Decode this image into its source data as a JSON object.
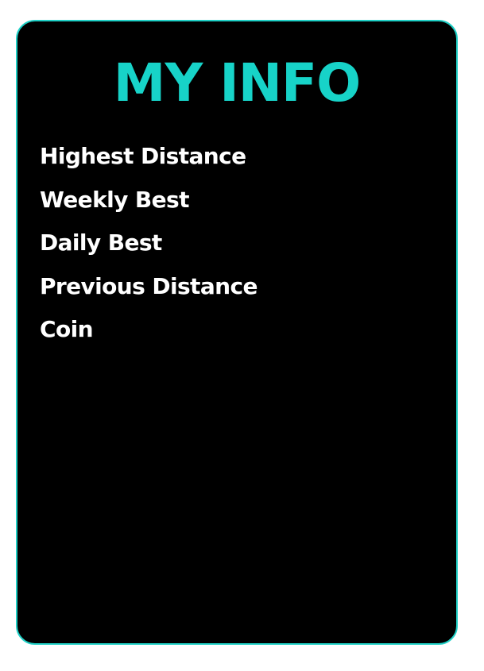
{
  "panel": {
    "title": "MY INFO",
    "items": [
      {
        "label": "Highest Distance"
      },
      {
        "label": "Weekly Best"
      },
      {
        "label": "Daily Best"
      },
      {
        "label": "Previous Distance"
      },
      {
        "label": "Coin"
      }
    ]
  },
  "colors": {
    "accent": "#17d3c8",
    "border": "#1fd0c6",
    "panel_background": "#000000",
    "text": "#ffffff",
    "page_background": "#ffffff"
  }
}
